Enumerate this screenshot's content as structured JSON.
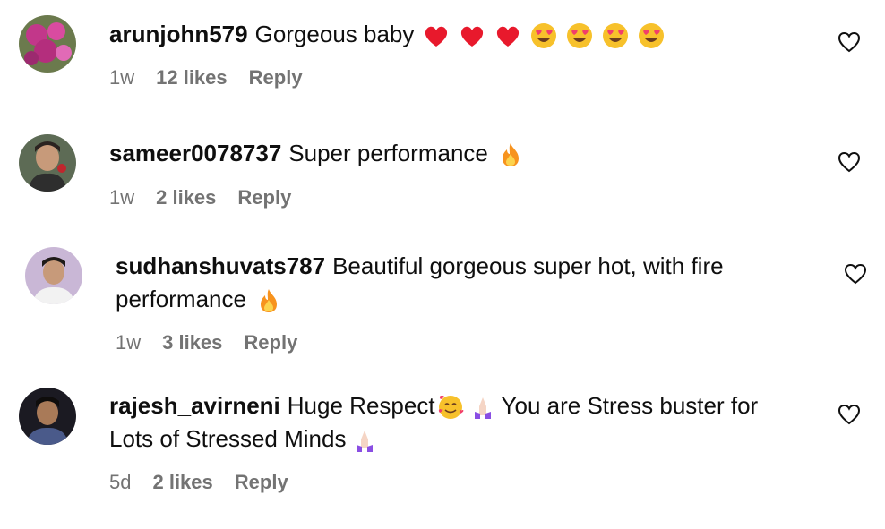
{
  "comments": [
    {
      "username": "arunjohn579",
      "text": "Gorgeous baby",
      "emojis": [
        "red-heart-icon",
        "red-heart-icon",
        "red-heart-icon",
        "heart-eyes-icon",
        "heart-eyes-icon",
        "heart-eyes-icon",
        "heart-eyes-icon"
      ],
      "time": "1w",
      "likes": "12 likes",
      "reply": "Reply"
    },
    {
      "username": "sameer0078737",
      "text": "Super performance",
      "emojis": [
        "fire-icon"
      ],
      "time": "1w",
      "likes": "2 likes",
      "reply": "Reply"
    },
    {
      "username": "sudhanshuvats787",
      "text_line1": "Beautiful gorgeous super hot, with fire",
      "text_line2": "performance",
      "emojis": [
        "fire-icon"
      ],
      "time": "1w",
      "likes": "3 likes",
      "reply": "Reply"
    },
    {
      "username": "rajesh_avirneni",
      "text_a": "Huge Respect",
      "text_b": "You are Stress buster for",
      "text_line2": "Lots of Stressed Minds",
      "time": "5d",
      "likes": "2 likes",
      "reply": "Reply"
    }
  ],
  "colors": {
    "meta": "#737373",
    "heart_red": "#e8192c",
    "emoji_yellow": "#f7c12b",
    "fire_orange": "#f7931e",
    "hands_purple": "#8a4ee3"
  }
}
